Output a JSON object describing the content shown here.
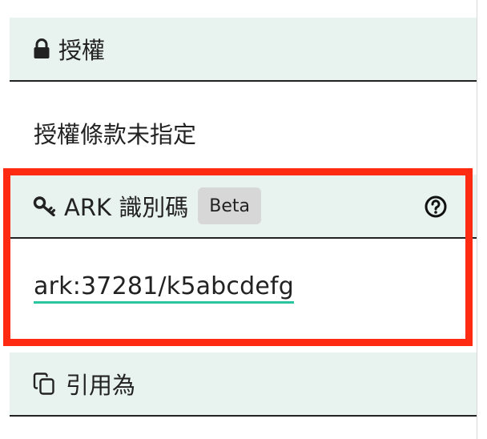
{
  "license": {
    "header_label": "授權",
    "header_icon": "lock-icon",
    "value": "授權條款未指定"
  },
  "ark": {
    "header_label": "ARK 識別碼",
    "header_icon": "key-icon",
    "badge": "Beta",
    "help_icon": "question-circle-icon",
    "identifier": "ark:37281/k5abcdefg"
  },
  "cite": {
    "header_label": "引用為",
    "header_icon": "copy-icon"
  },
  "colors": {
    "header_bg": "#e8f2ee",
    "link_underline": "#2bc4a0",
    "highlight": "#ff2a12",
    "badge_bg": "#d7d7d7"
  }
}
